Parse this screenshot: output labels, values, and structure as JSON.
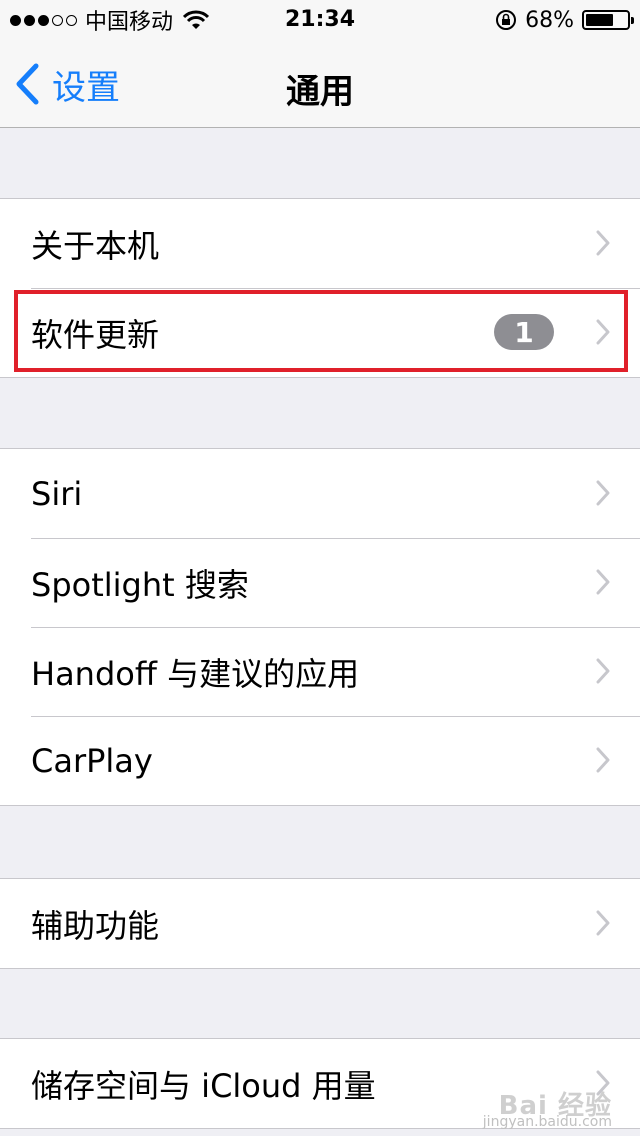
{
  "status_bar": {
    "signal_dots": [
      true,
      true,
      true,
      false,
      false
    ],
    "carrier": "中国移动",
    "time": "21:34",
    "battery_percent": "68%",
    "battery_level": 0.68
  },
  "nav": {
    "back_label": "设置",
    "title": "通用"
  },
  "groups": [
    {
      "rows": [
        {
          "label": "关于本机",
          "badge": null
        },
        {
          "label": "软件更新",
          "badge": "1",
          "highlighted": true
        }
      ]
    },
    {
      "rows": [
        {
          "label": "Siri"
        },
        {
          "label": "Spotlight 搜索"
        },
        {
          "label": "Handoff 与建议的应用"
        },
        {
          "label": "CarPlay"
        }
      ]
    },
    {
      "rows": [
        {
          "label": "辅助功能"
        }
      ]
    },
    {
      "rows": [
        {
          "label": "储存空间与 iCloud 用量"
        }
      ]
    }
  ],
  "colors": {
    "accent": "#157efb",
    "badge": "#8e8e93",
    "highlight": "#e0202a",
    "background": "#efeff4"
  },
  "watermark": {
    "logo": "Bai 经验",
    "url": "jingyan.baidu.com"
  }
}
